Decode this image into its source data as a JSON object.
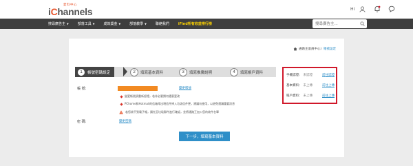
{
  "header": {
    "logo_sub": "愛料中心",
    "logo_pre": "i",
    "logo_o": "C",
    "logo_post": "hannels",
    "user_name": "Hi"
  },
  "nav": {
    "items": [
      {
        "label": "搜尋廣告主",
        "caret": "▼"
      },
      {
        "label": "部落工具",
        "caret": "▼"
      },
      {
        "label": "成效獎金",
        "caret": "▼"
      },
      {
        "label": "部落教學",
        "caret": "▼"
      },
      {
        "label": "聯絡我們",
        "caret": ""
      },
      {
        "label": "iFind所有收益排行榜",
        "caret": ""
      }
    ],
    "search_placeholder": "搜尋廣告主..."
  },
  "breadcrumb": {
    "home": "通路王會員中心",
    "separator": "〉",
    "current": "帳號設定"
  },
  "steps": [
    {
      "num": "1",
      "label": "帳號密碼設定"
    },
    {
      "num": "2",
      "label": "填寫基本資料"
    },
    {
      "num": "3",
      "label": "填寫推廣說明"
    },
    {
      "num": "4",
      "label": "填寫帳戶資料"
    }
  ],
  "form": {
    "account_label": "帳 號:",
    "change_account": "變更帳號",
    "note1": "變更帳號須重新認證，若非必要請勿隨意更改",
    "note2": "PChome和Hotmail的信箱常出現信件掉入垃圾信件匣，建議勿使用，以避免遺漏重要訊息",
    "warn_note": "若您收不到電子報，請先至垃圾郵件進行確認，並將通路王加入您的收件名單",
    "password_label": "密 碼:",
    "change_password": "變更密碼",
    "next_button": "下一步，填寫基本資料"
  },
  "status": {
    "rows": [
      {
        "label": "手機認證：",
        "value": "未認證",
        "action": "前往認證"
      },
      {
        "label": "基本資料：",
        "value": "未上傳",
        "action": "前往上傳"
      },
      {
        "label": "帳戶資料：",
        "value": "未上傳",
        "action": "前往上傳"
      }
    ]
  },
  "colors": {
    "accent": "#2f8fc8",
    "brand_orange": "#e8542b",
    "status_border": "#d0182a"
  }
}
